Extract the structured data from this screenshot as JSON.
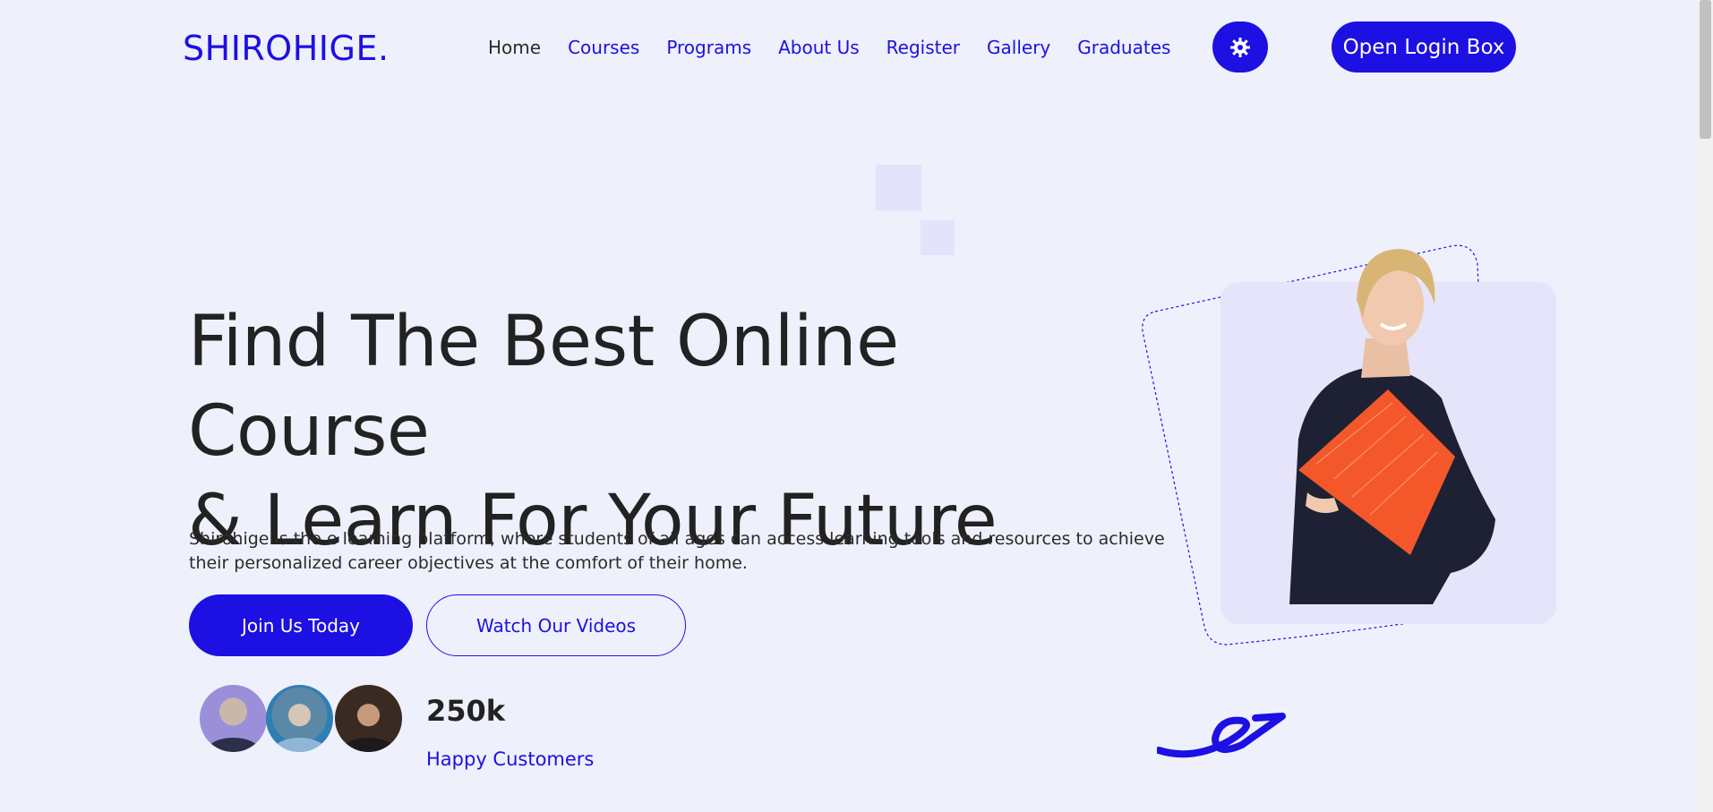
{
  "header": {
    "logo": "SHIROHIGE.",
    "nav": [
      "Home",
      "Courses",
      "Programs",
      "About Us",
      "Register",
      "Gallery",
      "Graduates"
    ],
    "theme_icon": "gear-icon",
    "login_label": "Open Login Box"
  },
  "hero": {
    "headline_line1": "Find The Best Online Course",
    "headline_line2": "& Learn For Your Future",
    "description": "Shirohige is the e learning platform, where students of all ages can access learning tools and resources to achieve their personalized career objectives at the comfort of their home.",
    "primary_button": "Join Us Today",
    "secondary_button": "Watch Our Videos",
    "stats": {
      "count": "250k",
      "label": "Happy Customers"
    }
  },
  "colors": {
    "accent": "#1d10e3",
    "background": "#eef0fb",
    "card": "#e6e4fb"
  }
}
